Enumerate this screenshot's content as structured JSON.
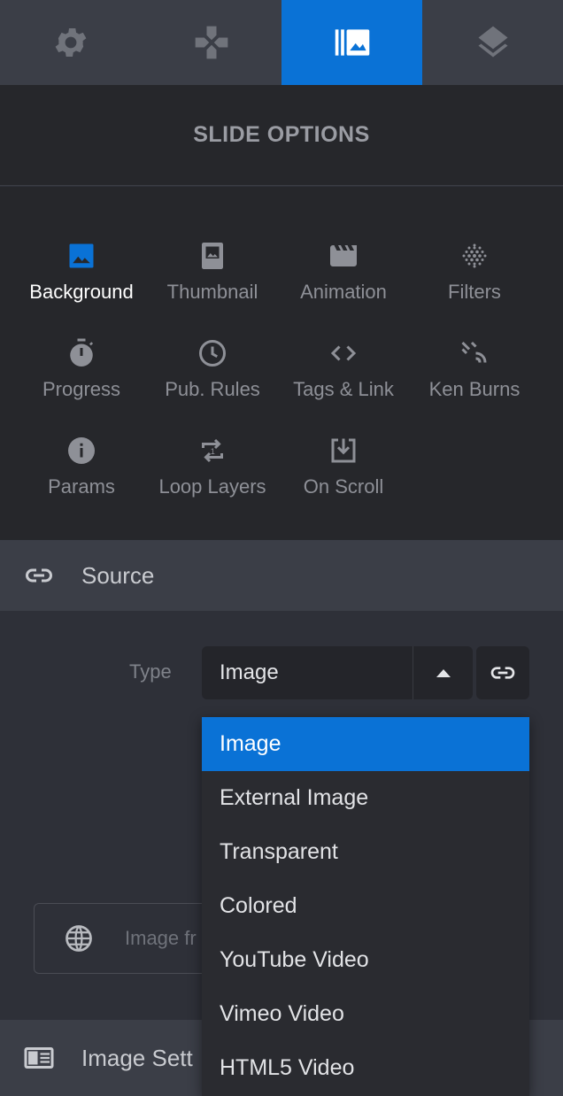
{
  "colors": {
    "accent": "#0a72d6",
    "panel": "#26272b",
    "bar": "#3b3e47",
    "background": "#2e3038"
  },
  "top_tabs": [
    {
      "icon": "gear-icon",
      "active": false
    },
    {
      "icon": "gamepad-icon",
      "active": false
    },
    {
      "icon": "slides-icon",
      "active": true
    },
    {
      "icon": "layers-icon",
      "active": false
    }
  ],
  "header": {
    "title": "SLIDE OPTIONS"
  },
  "options": [
    {
      "label": "Background",
      "icon": "image-icon",
      "active": true
    },
    {
      "label": "Thumbnail",
      "icon": "thumbnail-icon",
      "active": false
    },
    {
      "label": "Animation",
      "icon": "clapperboard-icon",
      "active": false
    },
    {
      "label": "Filters",
      "icon": "dots-grid-icon",
      "active": false
    },
    {
      "label": "Progress",
      "icon": "stopwatch-icon",
      "active": false
    },
    {
      "label": "Pub. Rules",
      "icon": "clock-icon",
      "active": false
    },
    {
      "label": "Tags & Link",
      "icon": "code-icon",
      "active": false
    },
    {
      "label": "Ken Burns",
      "icon": "ken-burns-icon",
      "active": false
    },
    {
      "label": "Params",
      "icon": "info-icon",
      "active": false
    },
    {
      "label": "Loop Layers",
      "icon": "loop-icon",
      "active": false
    },
    {
      "label": "On Scroll",
      "icon": "scroll-download-icon",
      "active": false
    }
  ],
  "source": {
    "title": "Source",
    "type_label": "Type",
    "type_value": "Image",
    "url_placeholder": "Image fr"
  },
  "dropdown": {
    "options": [
      "Image",
      "External Image",
      "Transparent",
      "Colored",
      "YouTube Video",
      "Vimeo Video",
      "HTML5 Video"
    ],
    "selected": "Image"
  },
  "image_settings": {
    "title": "Image Sett"
  }
}
